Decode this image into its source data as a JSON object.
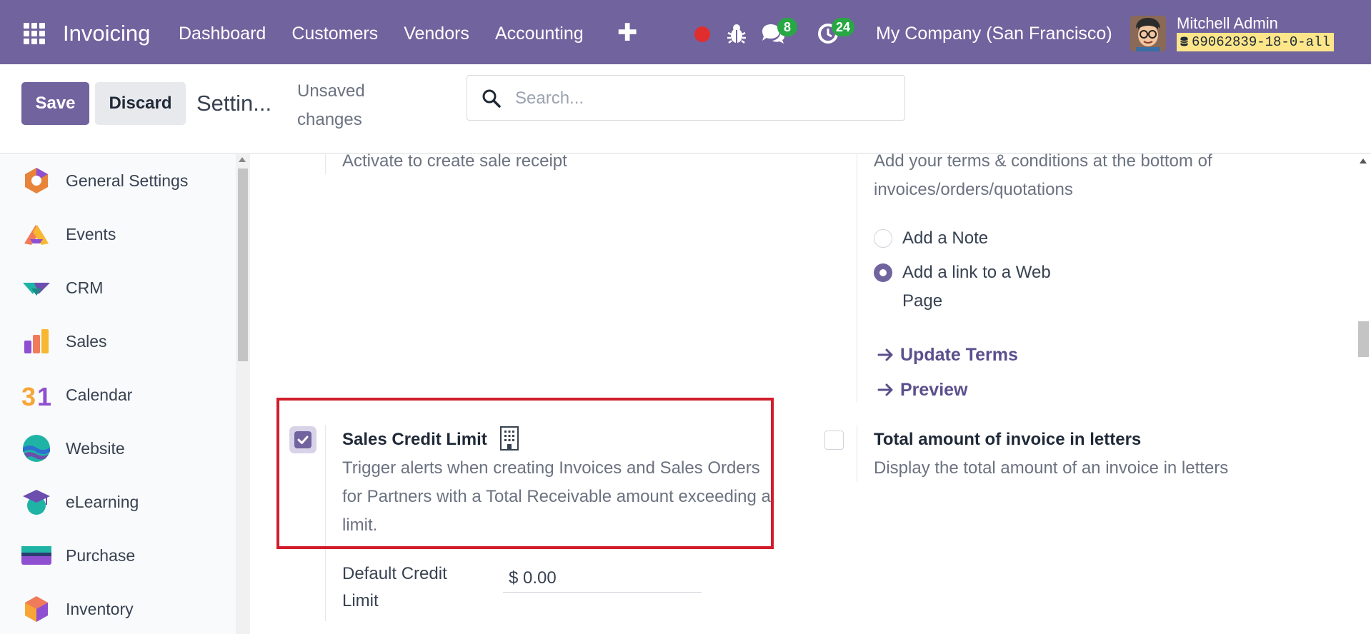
{
  "navbar": {
    "app_name": "Invoicing",
    "menu": [
      "Dashboard",
      "Customers",
      "Vendors",
      "Accounting"
    ],
    "plus": "✚",
    "messages_count": "8",
    "activities_count": "24",
    "company": "My Company (San Francisco)",
    "user_name": "Mitchell Admin",
    "database": "69062839-18-0-all",
    "colors": {
      "bar": "#71639e",
      "badge": "#28a745",
      "record": "#e02e2e"
    }
  },
  "control_panel": {
    "save_label": "Save",
    "discard_label": "Discard",
    "breadcrumb": "Settin...",
    "unsaved": "Unsaved changes",
    "search_placeholder": "Search..."
  },
  "sidebar": {
    "items": [
      {
        "label": "General Settings",
        "icon": "general-settings-icon"
      },
      {
        "label": "Events",
        "icon": "events-icon"
      },
      {
        "label": "CRM",
        "icon": "crm-icon"
      },
      {
        "label": "Sales",
        "icon": "sales-icon"
      },
      {
        "label": "Calendar",
        "icon": "calendar-icon"
      },
      {
        "label": "Website",
        "icon": "website-icon"
      },
      {
        "label": "eLearning",
        "icon": "elearning-icon"
      },
      {
        "label": "Purchase",
        "icon": "purchase-icon"
      },
      {
        "label": "Inventory",
        "icon": "inventory-icon"
      }
    ]
  },
  "settings": {
    "sale_receipt_desc": "Activate to create sale receipt",
    "terms": {
      "desc": "Add your terms & conditions at the bottom of invoices/orders/quotations",
      "option_note": "Add a Note",
      "option_link": "Add a link to a Web Page",
      "selected": "Add a link to a Web Page",
      "update_terms": "Update Terms",
      "preview": "Preview"
    },
    "credit_limit": {
      "title": "Sales Credit Limit",
      "desc": "Trigger alerts when creating Invoices and Sales Orders for Partners with a Total Receivable amount exceeding a limit.",
      "checked": true,
      "default_label": "Default Credit Limit",
      "default_value": "$ 0.00"
    },
    "invoice_letters": {
      "title": "Total amount of invoice in letters",
      "desc": "Display the total amount of an invoice in letters",
      "checked": false
    }
  }
}
